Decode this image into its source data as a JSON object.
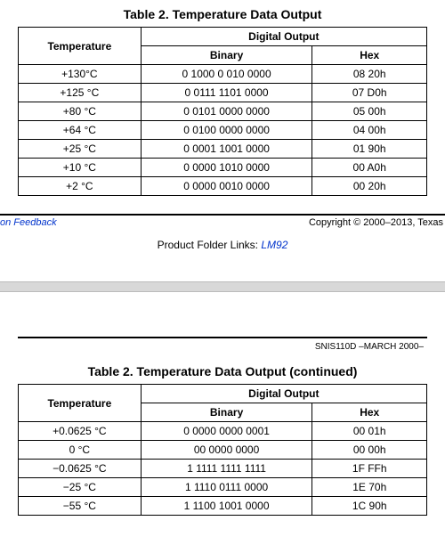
{
  "table1": {
    "caption": "Table 2. Temperature Data Output",
    "headers": {
      "temp": "Temperature",
      "digital": "Digital Output",
      "binary": "Binary",
      "hex": "Hex"
    },
    "rows": [
      {
        "temp": "+130°C",
        "binary": "0 1000 0 010 0000",
        "hex": "08 20h"
      },
      {
        "temp": "+125 °C",
        "binary": "0 0111 1101 0000",
        "hex": "07 D0h"
      },
      {
        "temp": "+80 °C",
        "binary": "0 0101 0000 0000",
        "hex": "05 00h"
      },
      {
        "temp": "+64 °C",
        "binary": "0 0100 0000 0000",
        "hex": "04 00h"
      },
      {
        "temp": "+25 °C",
        "binary": "0 0001 1001 0000",
        "hex": "01 90h"
      },
      {
        "temp": "+10 °C",
        "binary": "0 0000 1010 0000",
        "hex": "00 A0h"
      },
      {
        "temp": "+2 °C",
        "binary": "0 0000 0010 0000",
        "hex": "00 20h"
      }
    ]
  },
  "footer": {
    "left_link": "on Feedback",
    "copyright": "Copyright © 2000–2013, Texas",
    "product_prefix": "Product Folder Links: ",
    "product_link": "LM92"
  },
  "page2": {
    "doc_id": "SNIS110D –MARCH 2000–"
  },
  "table2": {
    "caption": "Table 2. Temperature Data Output (continued)",
    "headers": {
      "temp": "Temperature",
      "digital": "Digital Output",
      "binary": "Binary",
      "hex": "Hex"
    },
    "rows": [
      {
        "temp": "+0.0625 °C",
        "binary": "0 0000 0000 0001",
        "hex": "00 01h"
      },
      {
        "temp": "0 °C",
        "binary": "00 0000 0000",
        "hex": "00 00h"
      },
      {
        "temp": "−0.0625 °C",
        "binary": "1 1111 1111 1111",
        "hex": "1F FFh"
      },
      {
        "temp": "−25 °C",
        "binary": "1 1110 0111 0000",
        "hex": "1E 70h"
      },
      {
        "temp": "−55 °C",
        "binary": "1 1100 1001 0000",
        "hex": "1C 90h"
      }
    ]
  },
  "chart_data": [
    {
      "type": "table",
      "title": "Table 2. Temperature Data Output",
      "columns": [
        "Temperature",
        "Binary",
        "Hex"
      ],
      "rows": [
        [
          "+130°C",
          "0 1000 0 010 0000",
          "08 20h"
        ],
        [
          "+125 °C",
          "0 0111 1101 0000",
          "07 D0h"
        ],
        [
          "+80 °C",
          "0 0101 0000 0000",
          "05 00h"
        ],
        [
          "+64 °C",
          "0 0100 0000 0000",
          "04 00h"
        ],
        [
          "+25 °C",
          "0 0001 1001 0000",
          "01 90h"
        ],
        [
          "+10 °C",
          "0 0000 1010 0000",
          "00 A0h"
        ],
        [
          "+2 °C",
          "0 0000 0010 0000",
          "00 20h"
        ]
      ]
    },
    {
      "type": "table",
      "title": "Table 2. Temperature Data Output (continued)",
      "columns": [
        "Temperature",
        "Binary",
        "Hex"
      ],
      "rows": [
        [
          "+0.0625 °C",
          "0 0000 0000 0001",
          "00 01h"
        ],
        [
          "0 °C",
          "00 0000 0000",
          "00 00h"
        ],
        [
          "−0.0625 °C",
          "1 1111 1111 1111",
          "1F FFh"
        ],
        [
          "−25 °C",
          "1 1110 0111 0000",
          "1E 70h"
        ],
        [
          "−55 °C",
          "1 1100 1001 0000",
          "1C 90h"
        ]
      ]
    }
  ]
}
